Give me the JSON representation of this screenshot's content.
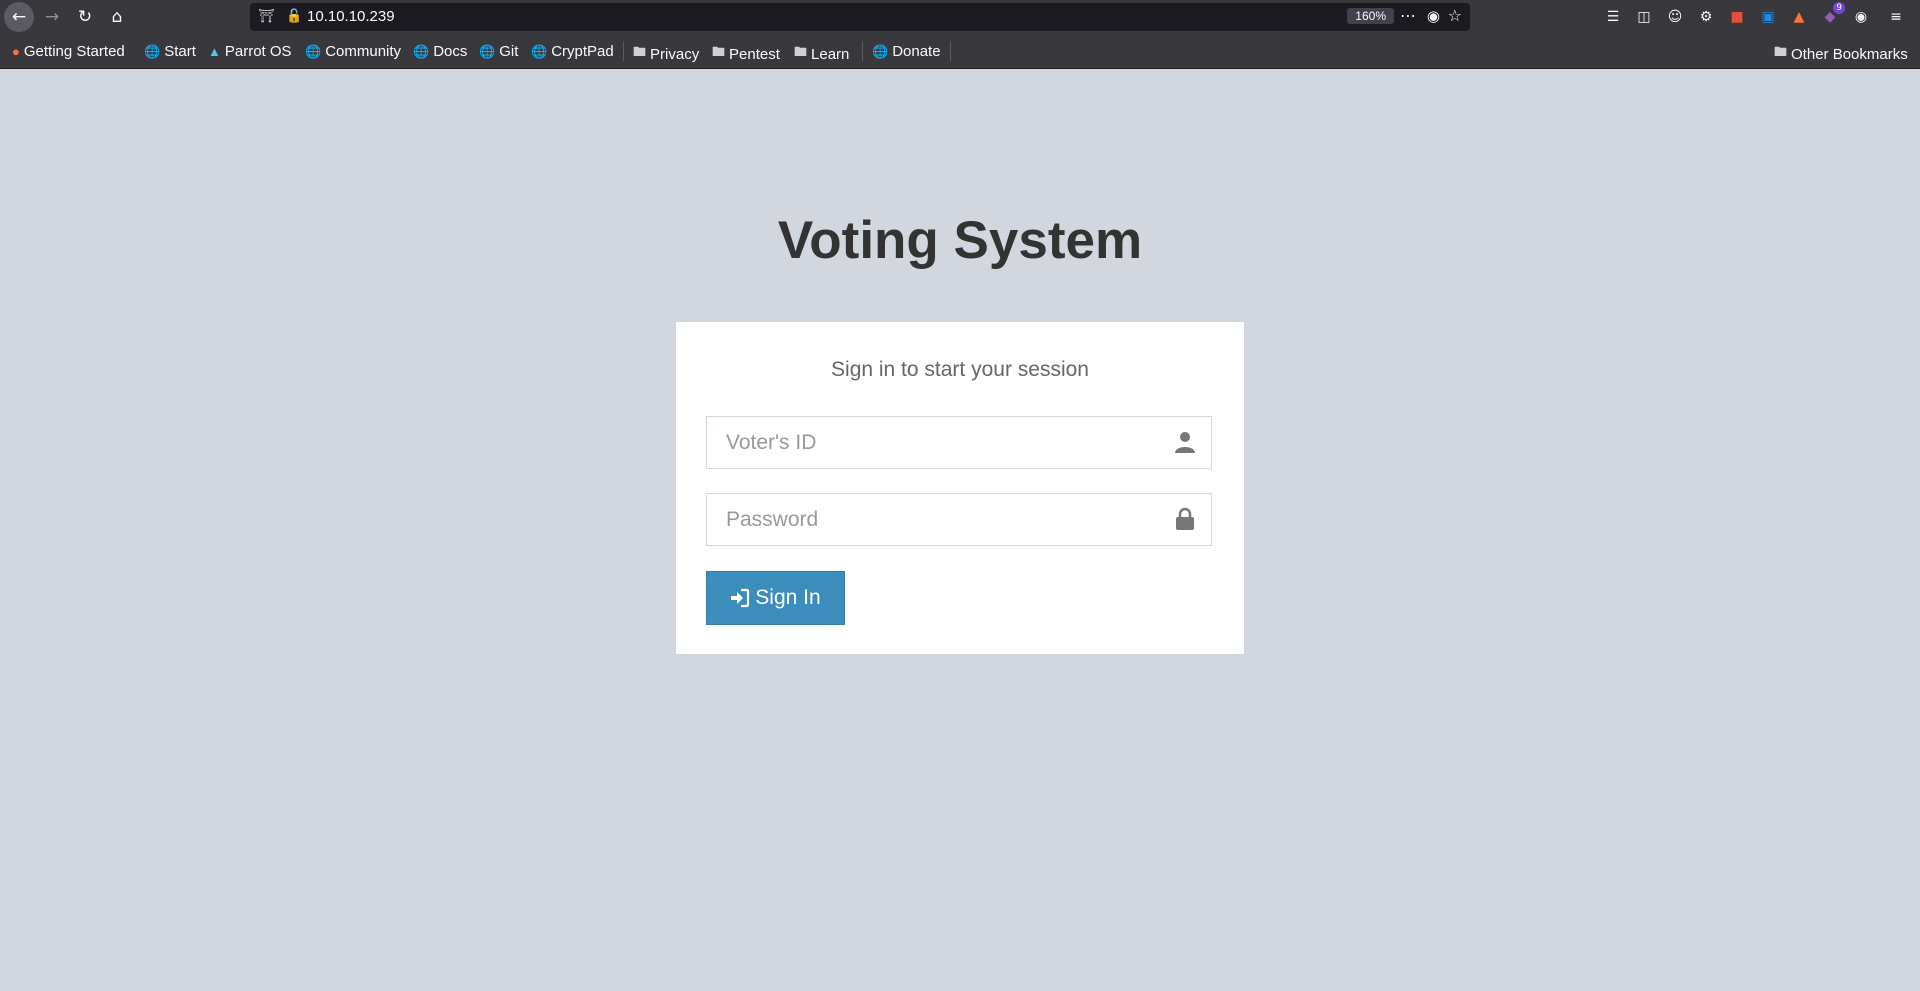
{
  "browser": {
    "url": "10.10.10.239",
    "zoom": "160%",
    "extension_badge_count": "9"
  },
  "bookmarks": {
    "items": [
      {
        "label": "Getting Started",
        "icon": "firefox-icon"
      },
      {
        "label": "Start",
        "icon": "globe-icon"
      },
      {
        "label": "Parrot OS",
        "icon": "parrot-icon"
      },
      {
        "label": "Community",
        "icon": "globe-icon"
      },
      {
        "label": "Docs",
        "icon": "globe-icon"
      },
      {
        "label": "Git",
        "icon": "globe-icon"
      },
      {
        "label": "CryptPad",
        "icon": "globe-icon"
      },
      {
        "label": "Privacy",
        "icon": "folder-icon"
      },
      {
        "label": "Pentest",
        "icon": "folder-icon"
      },
      {
        "label": "Learn",
        "icon": "folder-icon"
      },
      {
        "label": "Donate",
        "icon": "globe-icon"
      }
    ],
    "other": "Other Bookmarks"
  },
  "page": {
    "title": "Voting System",
    "login_message": "Sign in to start your session",
    "voter_id_placeholder": "Voter's ID",
    "password_placeholder": "Password",
    "signin_label": "Sign In"
  },
  "colors": {
    "page_background": "#d2d6de",
    "primary_button": "#3c8dbc",
    "browser_chrome": "#38383d"
  }
}
